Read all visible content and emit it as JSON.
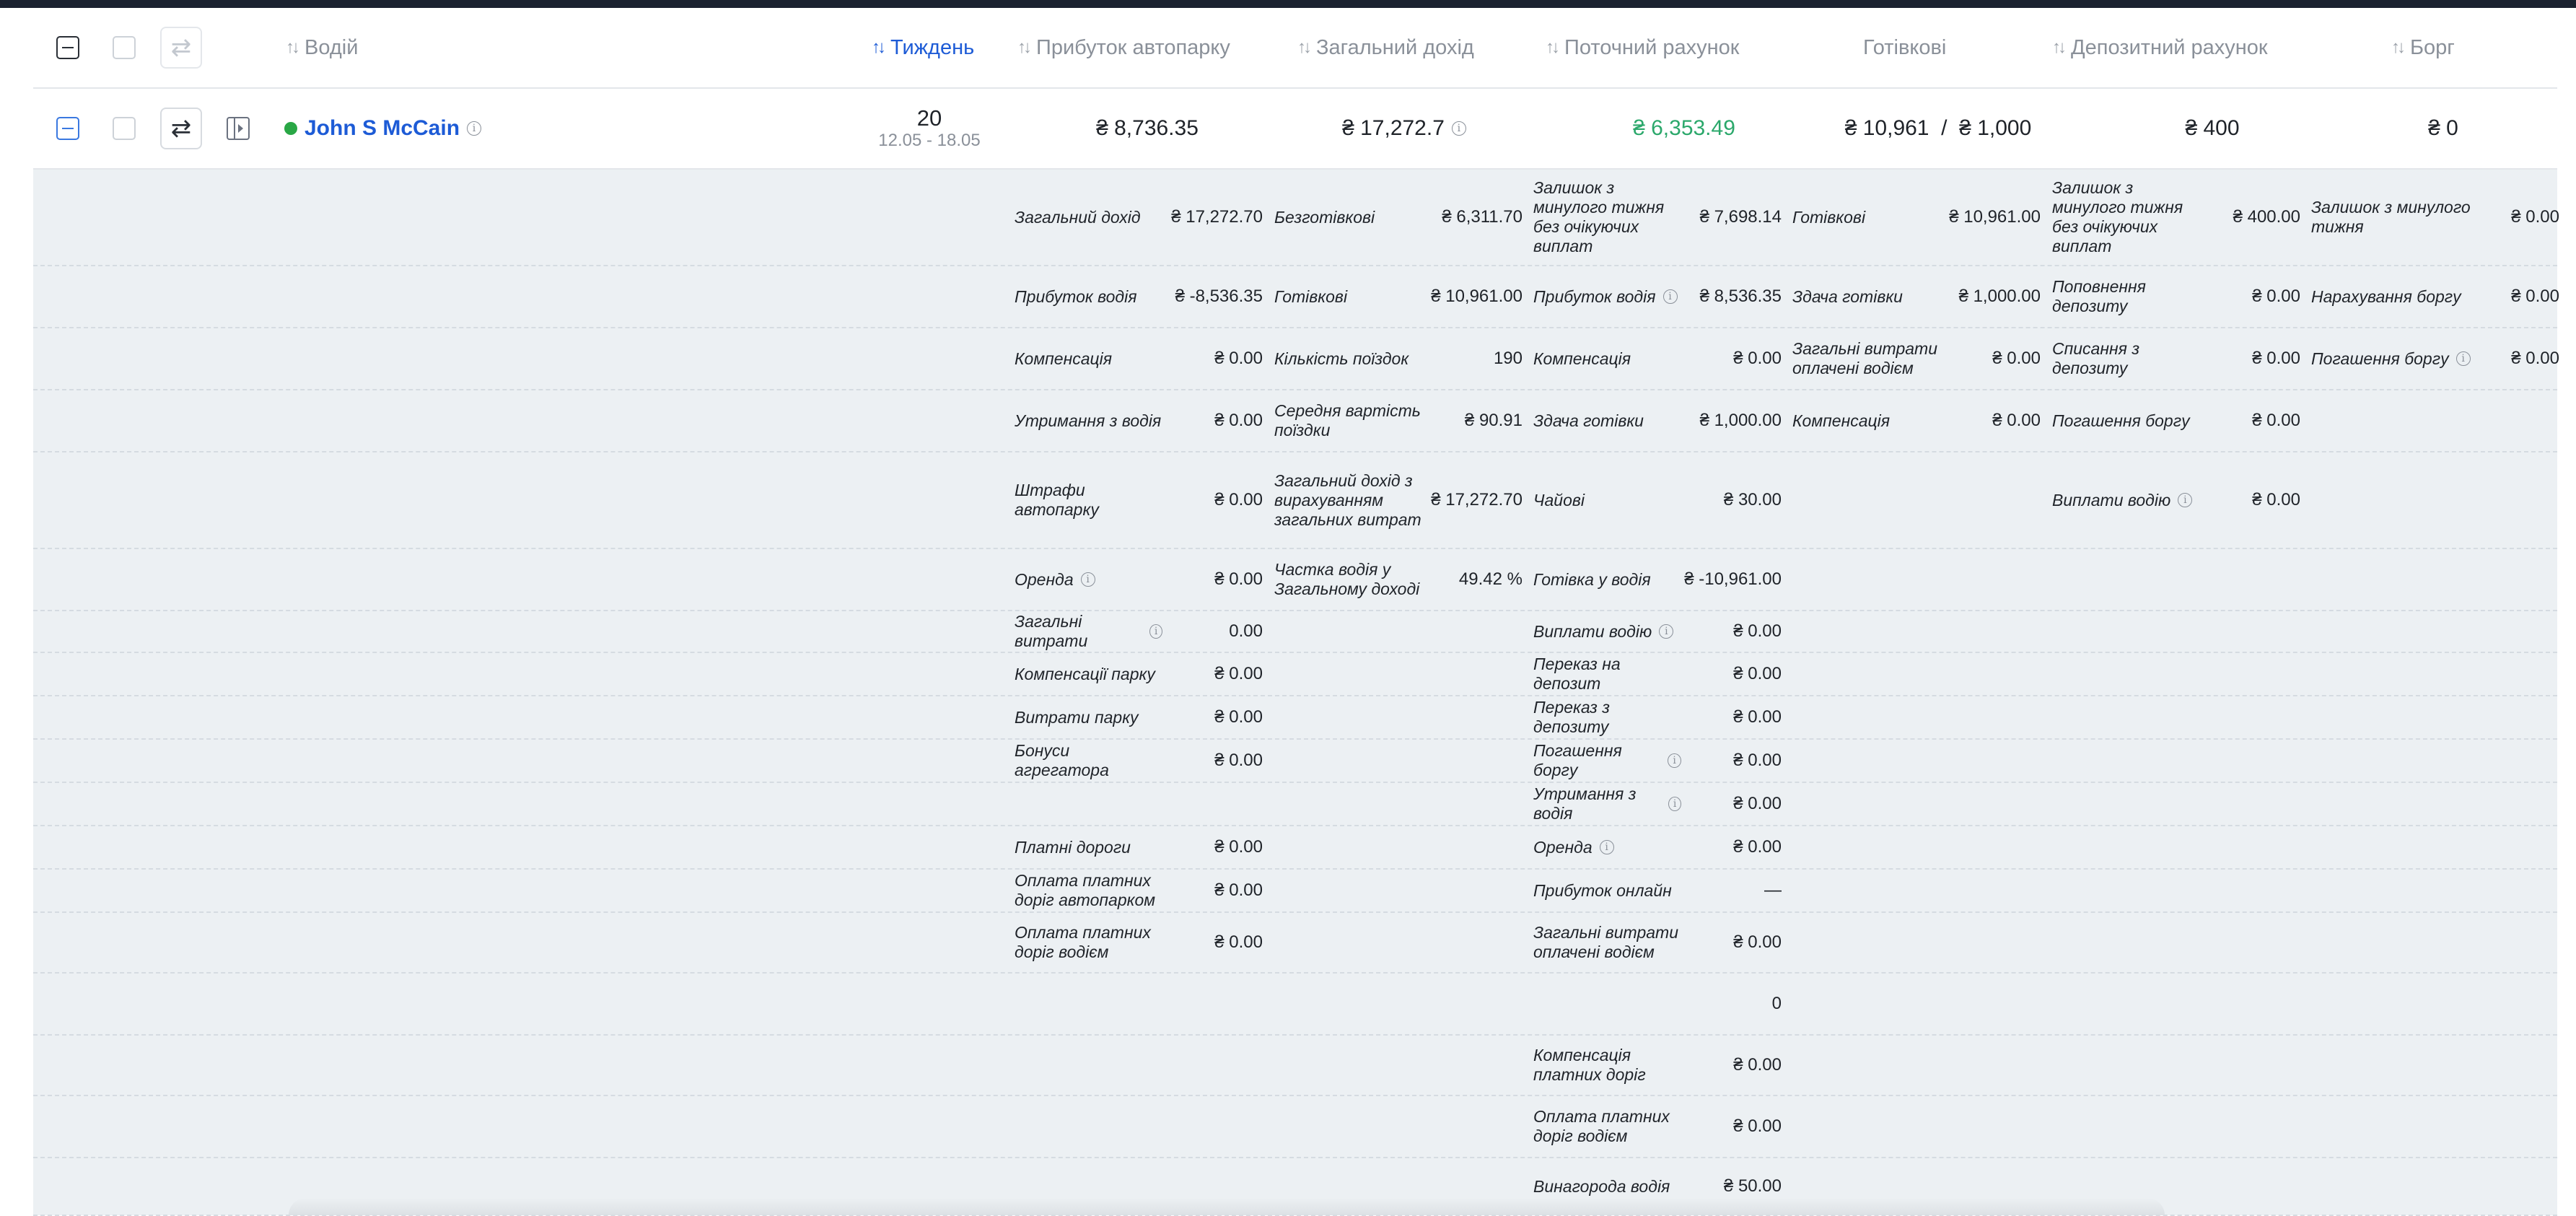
{
  "header": {
    "columns": {
      "driver": "Водій",
      "week": "Тиждень",
      "fleet_profit": "Прибуток автопарку",
      "total_income": "Загальний дохід",
      "current_account": "Поточний рахунок",
      "cash": "Готівкові",
      "deposit_account": "Депозитний рахунок",
      "debt": "Борг"
    }
  },
  "row": {
    "driver_name": "John S McCain",
    "week_number": "20",
    "week_range": "12.05 - 18.05",
    "fleet_profit": "₴ 8,736.35",
    "total_income": "₴ 17,272.7",
    "current_account": "₴ 6,353.49",
    "cash": "₴ 10,961  /  ₴ 1,000",
    "deposit_account": "₴ 400",
    "debt": "₴ 0",
    "status_color": "#29a745"
  },
  "details": {
    "c1": [
      {
        "label": "Загальний дохід",
        "value": "₴ 17,272.70"
      },
      {
        "label": "Прибуток водія",
        "value": "₴ -8,536.35"
      },
      {
        "label": "Компенсація",
        "value": "₴ 0.00"
      },
      {
        "label": "Утримання з водія",
        "value": "₴ 0.00"
      },
      {
        "label": "Штрафи автопарку",
        "value": "₴ 0.00"
      },
      {
        "label": "Оренда",
        "value": "₴ 0.00"
      },
      {
        "label": "Загальні витрати",
        "value": "0.00"
      },
      {
        "label": "Компенсації парку",
        "value": "₴ 0.00"
      },
      {
        "label": "Витрати парку",
        "value": "₴ 0.00"
      },
      {
        "label": "Бонуси агрегатора",
        "value": "₴ 0.00"
      },
      {
        "label": "Платні дороги",
        "value": "₴ 0.00"
      },
      {
        "label": "Оплата платних доріг автопарком",
        "value": "₴ 0.00"
      },
      {
        "label": "Оплата платних доріг водієм",
        "value": "₴ 0.00"
      }
    ],
    "c2": [
      {
        "label": "Безготівкові",
        "value": "₴ 6,311.70"
      },
      {
        "label": "Готівкові",
        "value": "₴ 10,961.00"
      },
      {
        "label": "Кількість поїздок",
        "value": "190"
      },
      {
        "label": "Середня вартість поїздки",
        "value": "₴ 90.91"
      },
      {
        "label": "Загальний дохід з вирахуванням загальних витрат",
        "value": "₴ 17,272.70"
      },
      {
        "label": "Частка водія у Загальному доході",
        "value": "49.42 %"
      }
    ],
    "c3": [
      {
        "label": "Залишок з минулого тижня без очікуючих виплат",
        "value": "₴ 7,698.14"
      },
      {
        "label": "Прибуток водія",
        "value": "₴ 8,536.35"
      },
      {
        "label": "Компенсація",
        "value": "₴ 0.00"
      },
      {
        "label": "Здача готівки",
        "value": "₴ 1,000.00"
      },
      {
        "label": "Чайові",
        "value": "₴ 30.00"
      },
      {
        "label": "Готівка у водія",
        "value": "₴ -10,961.00"
      },
      {
        "label": "Виплати водію",
        "value": "₴ 0.00"
      },
      {
        "label": "Переказ на депозит",
        "value": "₴ 0.00"
      },
      {
        "label": "Переказ з депозиту",
        "value": "₴ 0.00"
      },
      {
        "label": "Погашення боргу",
        "value": "₴ 0.00"
      },
      {
        "label": "Утримання з водія",
        "value": "₴ 0.00"
      },
      {
        "label": "Оренда",
        "value": "₴ 0.00"
      },
      {
        "label": "Прибуток онлайн",
        "value": "—"
      },
      {
        "label": "Загальні витрати оплачені водієм",
        "value": "₴ 0.00"
      },
      {
        "label": "",
        "value": "0"
      },
      {
        "label": "Компенсація платних доріг",
        "value": "₴ 0.00"
      },
      {
        "label": "Оплата платних доріг водієм",
        "value": "₴ 0.00"
      },
      {
        "label": "Винагорода водія",
        "value": "₴ 50.00"
      }
    ],
    "c4": [
      {
        "label": "Готівкові",
        "value": "₴ 10,961.00"
      },
      {
        "label": "Здача готівки",
        "value": "₴ 1,000.00"
      },
      {
        "label": "Загальні витрати оплачені водієм",
        "value": "₴ 0.00"
      },
      {
        "label": "Компенсація",
        "value": "₴ 0.00"
      }
    ],
    "c5": [
      {
        "label": "Залишок з минулого тижня без очікуючих виплат",
        "value": "₴ 400.00"
      },
      {
        "label": "Поповнення депозиту",
        "value": "₴ 0.00"
      },
      {
        "label": "Списання з депозиту",
        "value": "₴ 0.00"
      },
      {
        "label": "Погашення боргу",
        "value": "₴ 0.00"
      },
      {
        "label": "Виплати водію",
        "value": "₴ 0.00"
      }
    ],
    "c6": [
      {
        "label": "Залишок з минулого тижня",
        "value": "₴ 0.00"
      },
      {
        "label": "Нарахування боргу",
        "value": "₴ 0.00"
      },
      {
        "label": "Погашення боргу",
        "value": "₴ 0.00"
      }
    ]
  }
}
